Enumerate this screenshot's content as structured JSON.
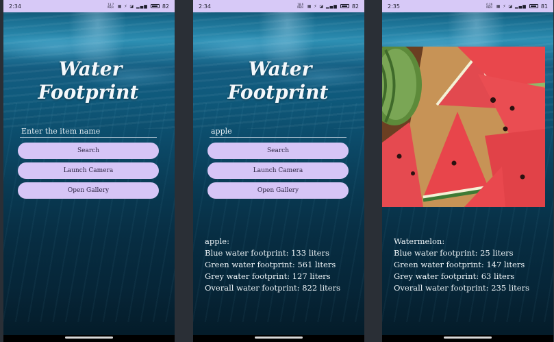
{
  "colors": {
    "statusbar": "#d7c9f7",
    "button": "#d6c5f6",
    "button_text": "#2a2240",
    "text_light": "#eef4f7"
  },
  "screens": [
    {
      "status": {
        "time": "2:34",
        "net": "13.7 KB/s",
        "icons": "▦ ⚡ ◪ ▂▄▆",
        "battery": "82"
      },
      "title": [
        "Water",
        "Footprint"
      ],
      "input": {
        "value": "",
        "placeholder": "Enter the item name"
      },
      "buttons": {
        "search": "Search",
        "camera": "Launch Camera",
        "gallery": "Open Gallery"
      },
      "result": null
    },
    {
      "status": {
        "time": "2:34",
        "net": "18.6 KB/s",
        "icons": "▦ ⚡ ◪ ▂▄▆",
        "battery": "82"
      },
      "title": [
        "Water",
        "Footprint"
      ],
      "input": {
        "value": "apple",
        "placeholder": "Enter the item name"
      },
      "buttons": {
        "search": "Search",
        "camera": "Launch Camera",
        "gallery": "Open Gallery"
      },
      "result": {
        "name": "apple:",
        "blue": "Blue water footprint: 133 liters",
        "green": "Green water footprint: 561 liters",
        "grey": "Grey water footprint: 127 liters",
        "overall": "Overall water footprint: 822 liters"
      }
    },
    {
      "status": {
        "time": "2:35",
        "net": "0.26 KB/s",
        "icons": "▦ ⚡ ◪ ▂▄▆",
        "battery": "81"
      },
      "image": {
        "subject": "watermelon-slices-photo"
      },
      "result": {
        "name": "Watermelon:",
        "blue": "Blue water footprint: 25 liters",
        "green": "Green water footprint: 147 liters",
        "grey": "Grey water footprint: 63 liters",
        "overall": "Overall water footprint: 235 liters"
      }
    }
  ]
}
